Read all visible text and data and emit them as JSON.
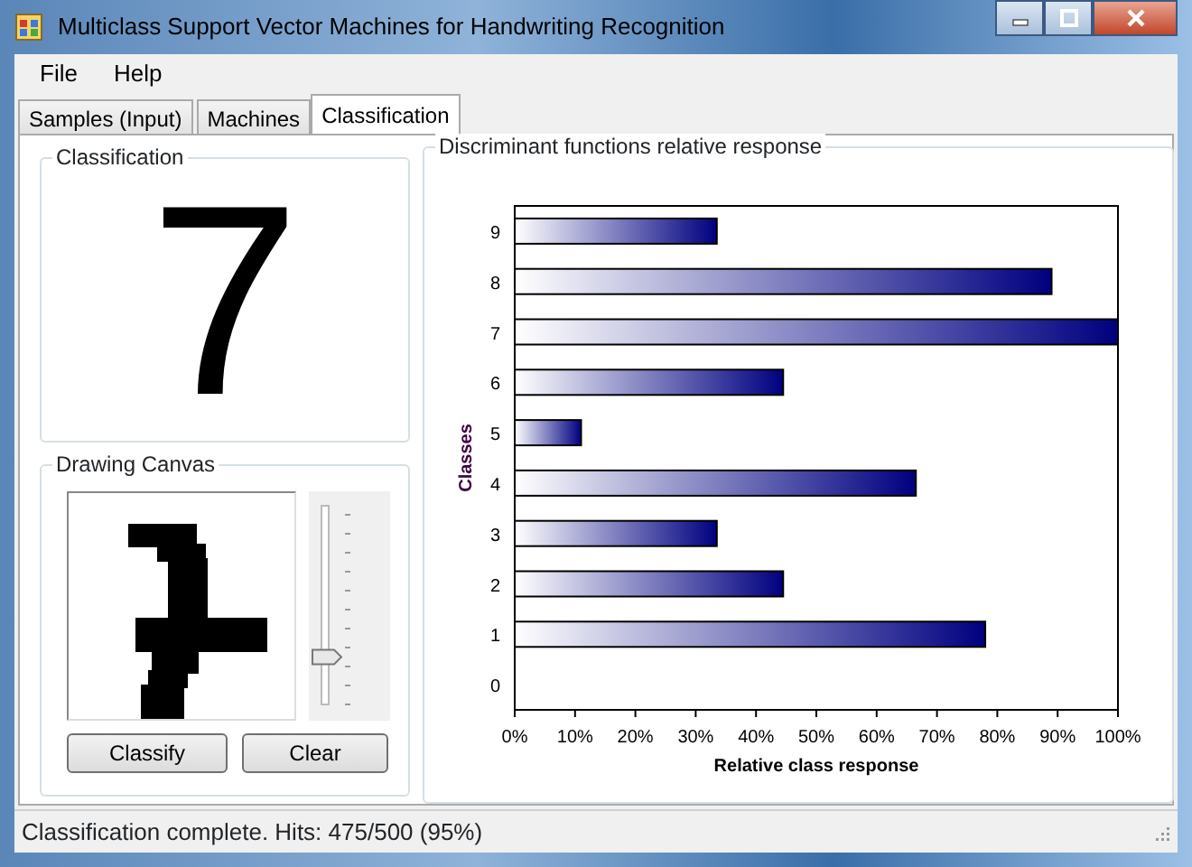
{
  "window": {
    "title": "Multiclass Support Vector Machines for Handwriting Recognition"
  },
  "menu": [
    "File",
    "Help"
  ],
  "tabs": [
    {
      "label": "Samples (Input)",
      "selected": false
    },
    {
      "label": "Machines",
      "selected": false
    },
    {
      "label": "Classification",
      "selected": true
    }
  ],
  "classification": {
    "title": "Classification",
    "result": "7"
  },
  "drawing_canvas": {
    "title": "Drawing Canvas",
    "slider": {
      "level": 0.25
    },
    "buttons": [
      "Classify",
      "Clear"
    ]
  },
  "response_panel": {
    "title": "Discriminant functions relative response",
    "chart_data": {
      "type": "bar",
      "orientation": "horizontal",
      "xlabel": "Relative class response",
      "ylabel": "Classes",
      "categories": [
        "9",
        "8",
        "7",
        "6",
        "5",
        "4",
        "3",
        "2",
        "1",
        "0"
      ],
      "values": [
        33.5,
        89,
        100,
        44.5,
        11,
        66.5,
        33.5,
        44.5,
        78,
        0
      ],
      "xlim": [
        0,
        100
      ],
      "xticks": [
        {
          "value": 0,
          "label": "0%"
        },
        {
          "value": 10,
          "label": "10%"
        },
        {
          "value": 20,
          "label": "20%"
        },
        {
          "value": 30,
          "label": "30%"
        },
        {
          "value": 40,
          "label": "40%"
        },
        {
          "value": 50,
          "label": "50%"
        },
        {
          "value": 60,
          "label": "60%"
        },
        {
          "value": 70,
          "label": "70%"
        },
        {
          "value": 80,
          "label": "80%"
        },
        {
          "value": 90,
          "label": "90%"
        },
        {
          "value": 100,
          "label": "100%"
        }
      ]
    }
  },
  "status_bar": "Classification complete. Hits: 475/500 (95%)"
}
